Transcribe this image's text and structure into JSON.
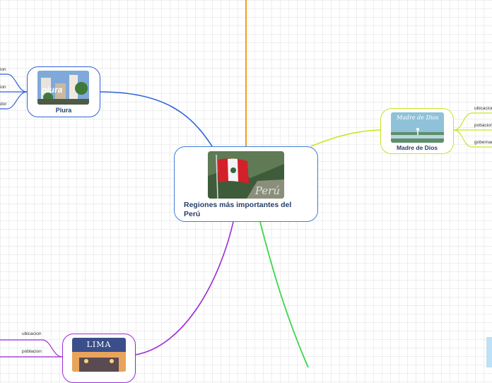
{
  "central": {
    "title": "Regiones más importantes del Perú",
    "image_text": "Perú"
  },
  "nodes": {
    "piura": {
      "label": "Piura",
      "image_text": "piura",
      "subtopics": [
        "ion",
        "ion",
        "dor"
      ]
    },
    "madre_de_dios": {
      "label": "Madre de Dios",
      "image_text": "Madre de Dios",
      "subtopics": [
        "ubicacion",
        "pobacion",
        "gobernad"
      ]
    },
    "lima": {
      "image_text": "LIMA",
      "subtopics": [
        "ubicacion",
        "poblacion"
      ]
    }
  },
  "colors": {
    "central": "#3d7fd6",
    "piura": "#2f62d6",
    "madre_de_dios": "#c6e620",
    "lima": "#9a2ad6",
    "orange": "#f29b1c",
    "green": "#3cd64a"
  }
}
